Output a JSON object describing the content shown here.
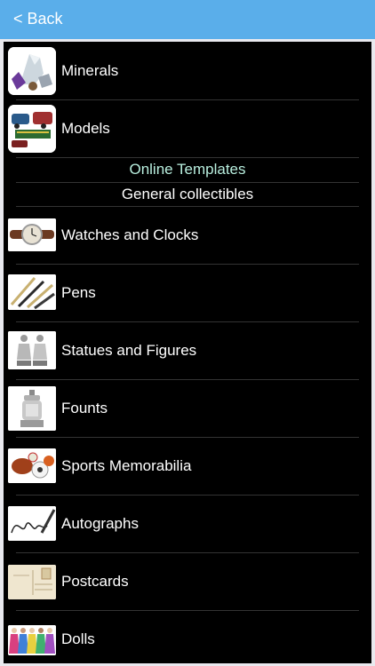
{
  "nav": {
    "back_label": "< Back"
  },
  "sections": {
    "online_templates": "Online Templates",
    "general_collectibles": "General collectibles"
  },
  "items": [
    {
      "label": "Minerals",
      "icon": "minerals-thumbnail"
    },
    {
      "label": "Models",
      "icon": "models-thumbnail"
    },
    {
      "label": "Watches and Clocks",
      "icon": "watch-thumbnail"
    },
    {
      "label": "Pens",
      "icon": "pens-thumbnail"
    },
    {
      "label": "Statues and Figures",
      "icon": "statues-thumbnail"
    },
    {
      "label": "Founts",
      "icon": "founts-thumbnail"
    },
    {
      "label": "Sports Memorabilia",
      "icon": "sports-thumbnail"
    },
    {
      "label": "Autographs",
      "icon": "autograph-thumbnail"
    },
    {
      "label": "Postcards",
      "icon": "postcard-thumbnail"
    },
    {
      "label": "Dolls",
      "icon": "dolls-thumbnail"
    }
  ],
  "colors": {
    "nav_bar": "#5aaeea",
    "list_background": "#000000",
    "link_text": "#b8eede"
  }
}
